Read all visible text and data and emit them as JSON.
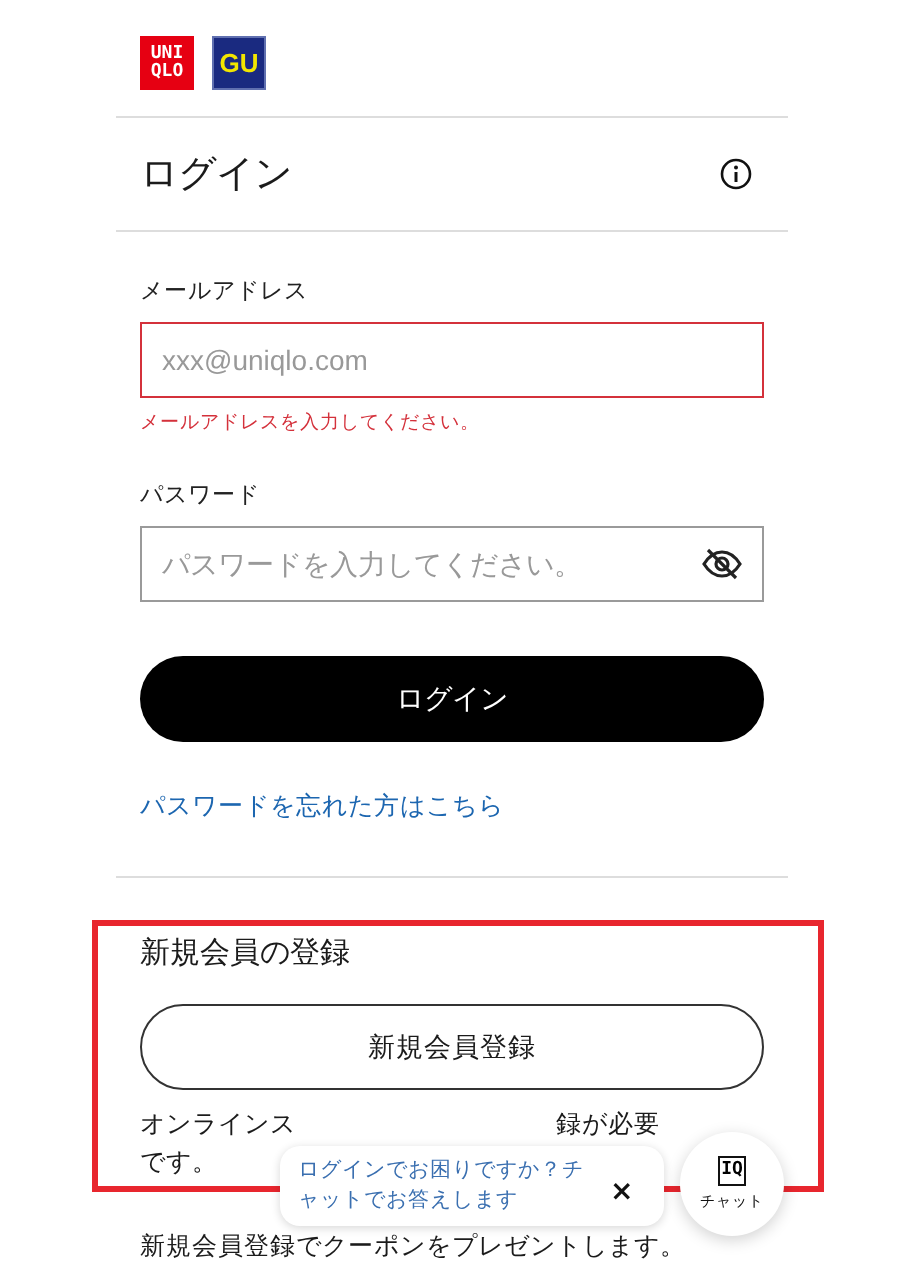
{
  "brand_logos": [
    {
      "kind": "uniqlo",
      "text": "UNI QLO"
    },
    {
      "kind": "gu",
      "text": "GU"
    }
  ],
  "header": {
    "title": "ログイン"
  },
  "form": {
    "fields": [
      {
        "label": "メールアドレス",
        "placeholder": "xxx@uniqlo.com",
        "error": "メールアドレスを入力してください。",
        "invalid": true,
        "kind": "text"
      },
      {
        "label": "パスワード",
        "placeholder": "パスワードを入力してください。",
        "invalid": false,
        "kind": "password"
      }
    ],
    "submit_button": "ログイン",
    "forgot_link": "パスワードを忘れた方はこちら"
  },
  "register": {
    "title": "新規会員の登録",
    "button": "新規会員登録",
    "note_line_1": [
      "オンラインス",
      "録が必要"
    ],
    "note_line_2": "です。",
    "note_line_3": "新規会員登録でクーポンをプレゼントします。",
    "highlighted": true
  },
  "chat_popup": {
    "message": "ログインでお困りですか？チャットでお答えします",
    "close": "×"
  },
  "chat_button": {
    "badge": "IQ",
    "label": "チャット"
  }
}
